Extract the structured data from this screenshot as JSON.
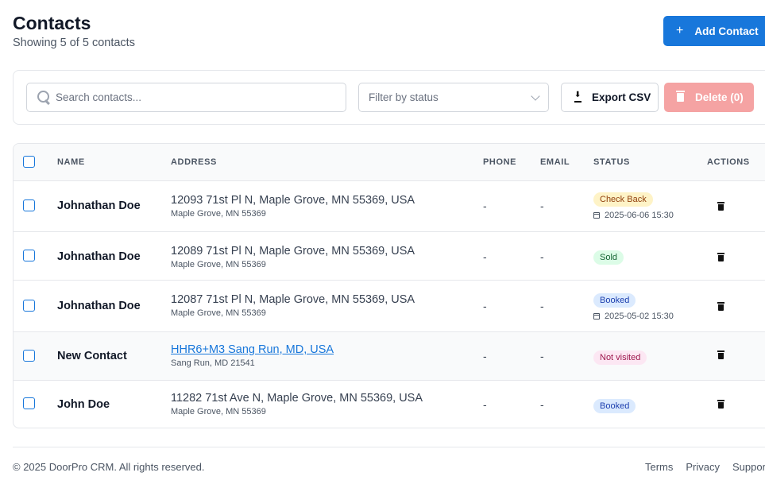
{
  "header": {
    "title": "Contacts",
    "subtitle": "Showing 5 of 5 contacts",
    "add_button": "Add Contact",
    "add_icon": "+"
  },
  "toolbar": {
    "search_placeholder": "Search contacts...",
    "filter_placeholder": "Filter by status",
    "export_label": "Export CSV",
    "delete_label": "Delete (0)"
  },
  "table": {
    "columns": [
      "NAME",
      "ADDRESS",
      "PHONE",
      "EMAIL",
      "STATUS",
      "ACTIONS"
    ],
    "rows": [
      {
        "name": "Johnathan Doe",
        "address": "12093 71st Pl N, Maple Grove, MN 55369, USA",
        "address_sub": "Maple Grove, MN 55369",
        "phone": "-",
        "email": "-",
        "status": "Check Back",
        "date": "2025-06-06 15:30"
      },
      {
        "name": "Johnathan Doe",
        "address": "12089 71st Pl N, Maple Grove, MN 55369, USA",
        "address_sub": "Maple Grove, MN 55369",
        "phone": "-",
        "email": "-",
        "status": "Sold",
        "date": ""
      },
      {
        "name": "Johnathan Doe",
        "address": "12087 71st Pl N, Maple Grove, MN 55369, USA",
        "address_sub": "Maple Grove, MN 55369",
        "phone": "-",
        "email": "-",
        "status": "Booked",
        "date": "2025-05-02 15:30"
      },
      {
        "name": "New Contact",
        "address": "HHR6+M3 Sang Run, MD, USA",
        "address_sub": "Sang Run, MD 21541",
        "phone": "-",
        "email": "-",
        "status": "Not visited",
        "date": ""
      },
      {
        "name": "John Doe",
        "address": "11282 71st Ave N, Maple Grove, MN 55369, USA",
        "address_sub": "Maple Grove, MN 55369",
        "phone": "-",
        "email": "-",
        "status": "Booked",
        "date": ""
      }
    ]
  },
  "footer": {
    "copyright": "© 2025 DoorPro CRM. All rights reserved.",
    "links": [
      "Terms",
      "Privacy",
      "Support"
    ]
  },
  "colors": {
    "primary": "#1877db",
    "danger_disabled": "#f5a3a3",
    "check_back": "#fef3c7",
    "sold": "#dcfce7",
    "booked": "#dbeafe",
    "not_visited": "#fce7f3"
  }
}
